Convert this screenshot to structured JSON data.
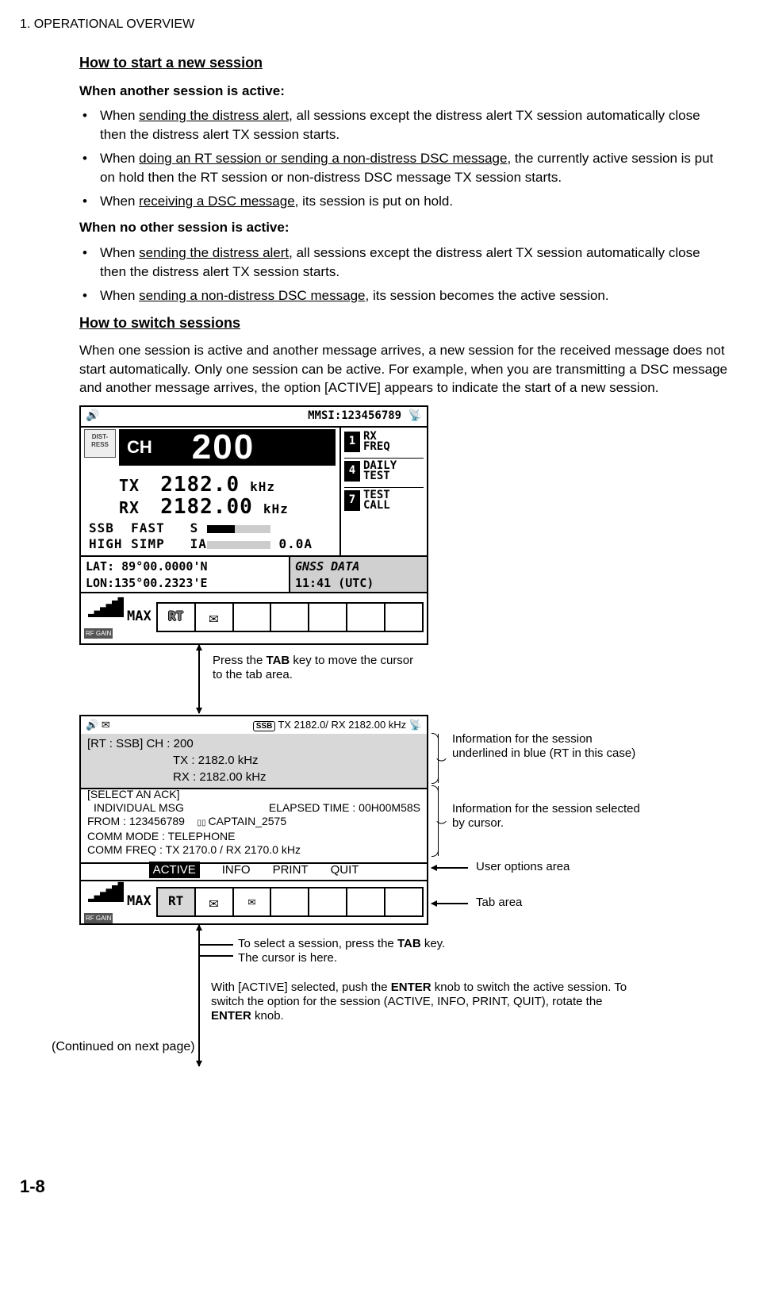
{
  "header": "1.  OPERATIONAL OVERVIEW",
  "page_num": "1-8",
  "h1": "How to start a new session",
  "p1": "When another session is active:",
  "li1a_pre": "When ",
  "li1a_u": "sending the distress alert",
  "li1a_post": ", all sessions except the distress alert TX session automatically close then the distress alert TX session starts.",
  "li1b_pre": " When ",
  "li1b_u": "doing an RT session or sending a non-distress DSC message",
  "li1b_post": ", the currently active session is put on hold then the RT session or non-distress DSC message TX session starts.",
  "li1c_pre": "When ",
  "li1c_u": "receiving a DSC message",
  "li1c_post": ", its session is put on hold.",
  "p2": "When no other session is active:",
  "li2a_pre": "When ",
  "li2a_u": "sending the distress alert",
  "li2a_post": ", all sessions except the distress alert TX session automatically close then the distress alert TX session starts.",
  "li2b_pre": "When ",
  "li2b_u": "sending a non-distress DSC message",
  "li2b_post": ", its session becomes the active session.",
  "h2": "How to switch sessions",
  "p3": "When one session is active and another message arrives, a new session for the received message does not start automatically. Only one session can be active. For example, when you are transmitting a DSC message and another message arrives, the option [ACTIVE] appears to indicate the start of a new session.",
  "top": {
    "mmsi": "MMSI:123456789",
    "distress": "DIST-RESS",
    "ch_lbl": "CH",
    "ch_val": "200",
    "tx_lbl": "TX",
    "tx_val": "2182.0",
    "rx_lbl": "RX",
    "rx_val": "2182.00",
    "khz": "kHz",
    "row1a": "SSB",
    "row1b": "FAST",
    "row1c": "S",
    "row2a": "HIGH",
    "row2b": "SIMP",
    "row2c": "IA",
    "amp": "0.0A",
    "menu1n": "1",
    "menu1t": "RX\nFREQ",
    "menu2n": "4",
    "menu2t": "DAILY\nTEST",
    "menu3n": "7",
    "menu3t": "TEST\nCALL",
    "lat": "LAT: 89°00.0000'N",
    "lon": "LON:135°00.2323'E",
    "gnss": "GNSS DATA",
    "time": "11:41 (UTC)",
    "rfgain": "RF GAIN",
    "max": "MAX",
    "rt": "RT"
  },
  "mid_lbl_a": "Press the ",
  "mid_lbl_b": "TAB",
  "mid_lbl_c": " key to move the cursor to the tab area.",
  "bot": {
    "hdr": "TX   2182.0/ RX   2182.00  kHz",
    "ssb": "SSB",
    "rt_line1": "[RT : SSB]     CH : 200",
    "rt_line2": "TX : 2182.0    kHz",
    "rt_line3": "RX : 2182.00  kHz",
    "ack_l1": "[SELECT AN ACK]",
    "ack_l2a": "INDIVIDUAL MSG",
    "ack_l2b": "ELAPSED TIME : 00H00M58S",
    "ack_l3a": "FROM          : 123456789",
    "ack_l3b": "CAPTAIN_2575",
    "ack_l4": "COMM MODE : TELEPHONE",
    "ack_l5": "COMM FREQ : TX  2170.0 / RX   2170.0  kHz",
    "opt_active": "ACTIVE",
    "opt_info": "INFO",
    "opt_print": "PRINT",
    "opt_quit": "QUIT",
    "rfgain": "RF GAIN",
    "max": "MAX",
    "rt": "RT"
  },
  "callouts": {
    "c1": "Information for the session underlined in blue (RT in this case)",
    "c2": "Information for the session selected by cursor.",
    "c3": "User options area",
    "c4": "Tab area",
    "c5a": "To select a session, press the ",
    "c5b": "TAB",
    "c5c": " key. The cursor is here.",
    "c6a": "With [ACTIVE] selected, push the ",
    "c6b": "ENTER",
    "c6c": " knob to switch the active session. To switch the option for the session (ACTIVE, INFO, PRINT, QUIT), rotate the ",
    "c6d": "ENTER",
    "c6e": " knob.",
    "cont": "(Continued on next page)"
  }
}
